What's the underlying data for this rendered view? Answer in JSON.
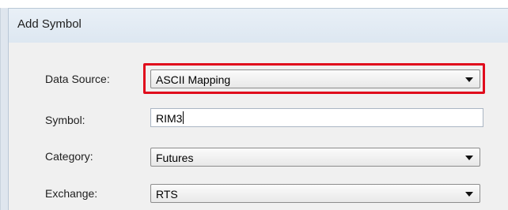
{
  "dialog": {
    "title": "Add Symbol"
  },
  "fields": {
    "data_source": {
      "label": "Data Source:",
      "value": "ASCII Mapping"
    },
    "symbol": {
      "label": "Symbol:",
      "value": "RIM3"
    },
    "category": {
      "label": "Category:",
      "value": "Futures"
    },
    "exchange": {
      "label": "Exchange:",
      "value": "RTS"
    }
  },
  "icons": {
    "dropdown": "chevron-down-icon"
  },
  "colors": {
    "highlight": "#e00b1c",
    "title_bar": "#dde7f1",
    "dialog_background": "#f0f0f0"
  }
}
